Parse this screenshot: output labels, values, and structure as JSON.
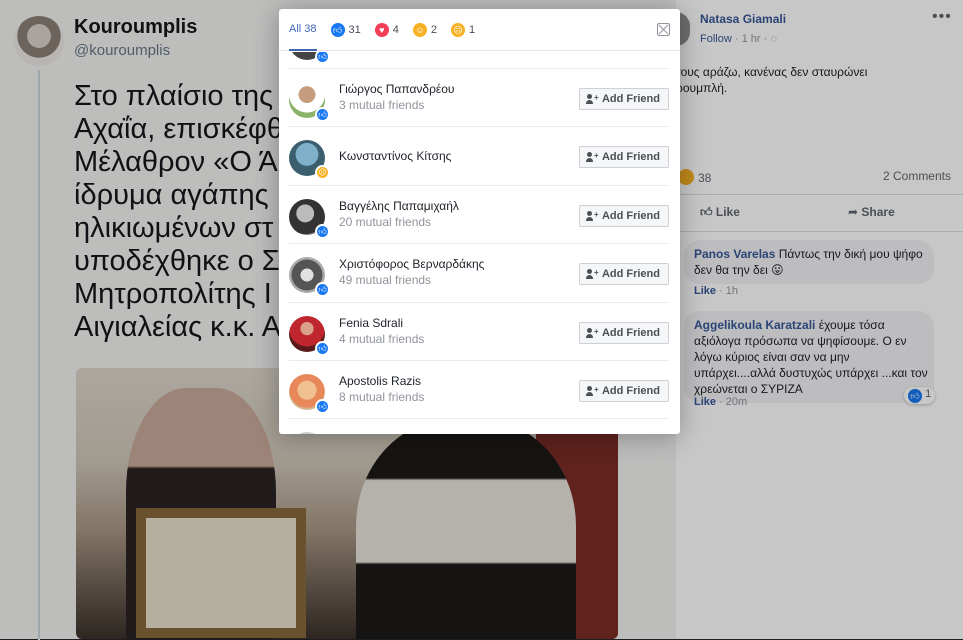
{
  "tweet": {
    "name": "Kouroumplis",
    "handle": "@kouroumplis",
    "text": "Στο πλαίσιο της\nΑχαΐα, επισκέφθ\nΜέλαθρον «Ο Ά\nίδρυμα αγάπης\nηλικιωμένων στ\nυποδέχθηκε ο Σ\nΜητροπολίτης Ι\nΑιγιαλείας κ.κ. Α"
  },
  "post": {
    "author": "Natasa Giamali",
    "follow_label": "Follow",
    "time": "· 1 hr ·",
    "text": "τους αράζω, κανένας δεν σταυρώνει\nρουμπλή.",
    "reaction_count": "38",
    "comments_label": "2 Comments",
    "like_label": "Like",
    "share_label": "Share",
    "comments": [
      {
        "author": "Panos Varelas",
        "text": "Πάντως την δική μου ψήφο\nδεν θα την δει 😛",
        "like": "Like",
        "time": "1h"
      },
      {
        "author": "Aggelikoula Karatzali",
        "text": "έχουμε τόσα\nαξιόλογα πρόσωπα να ψηφίσουμε. Ο εν\nλόγω κύριος είναι σαν να μην\nυπάρχει....αλλά δυστυχώς υπάρχει ...και τον\nχρεώνεται ο ΣΥΡΙΖΑ",
        "like": "Like",
        "time": "20m",
        "likes": "1"
      }
    ]
  },
  "dialog": {
    "tabs": [
      {
        "label": "All 38",
        "icon": "none"
      },
      {
        "label": "31",
        "icon": "like-reaction-icon"
      },
      {
        "label": "4",
        "icon": "love-reaction-icon"
      },
      {
        "label": "2",
        "icon": "haha-reaction-icon"
      },
      {
        "label": "1",
        "icon": "sad-reaction-icon"
      }
    ],
    "add_friend_label": "Add Friend",
    "people": [
      {
        "name": "Γιώργος Παπανδρέου",
        "mutual": "3 mutual friends",
        "reaction": "like"
      },
      {
        "name": "Κωνσταντίνος Κίτσης",
        "mutual": "",
        "reaction": "sad"
      },
      {
        "name": "Βαγγέλης Παπαμιχαήλ",
        "mutual": "20 mutual friends",
        "reaction": "like"
      },
      {
        "name": "Χριστόφορος Βερναρδάκης",
        "mutual": "49 mutual friends",
        "reaction": "like"
      },
      {
        "name": "Fenia Sdrali",
        "mutual": "4 mutual friends",
        "reaction": "like"
      },
      {
        "name": "Apostolis Razis",
        "mutual": "8 mutual friends",
        "reaction": "like"
      }
    ]
  }
}
